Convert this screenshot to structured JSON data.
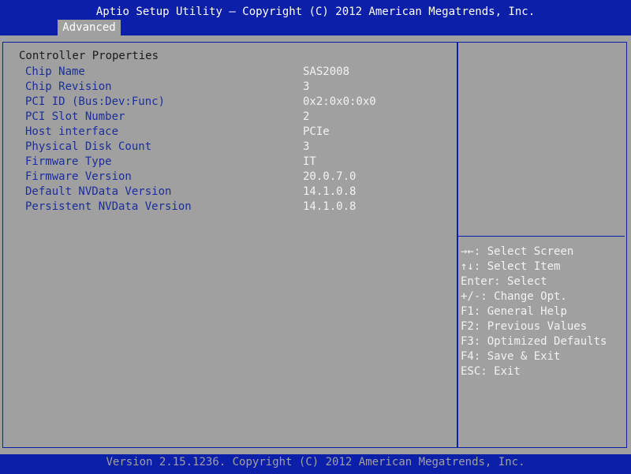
{
  "header": {
    "title": "Aptio Setup Utility – Copyright (C) 2012 American Megatrends, Inc.",
    "active_tab": "Advanced"
  },
  "section_title": "Controller Properties",
  "properties": [
    {
      "label": "Chip Name",
      "value": "SAS2008"
    },
    {
      "label": "Chip Revision",
      "value": "3"
    },
    {
      "label": "PCI ID (Bus:Dev:Func)",
      "value": "0x2:0x0:0x0"
    },
    {
      "label": "PCI Slot Number",
      "value": "2"
    },
    {
      "label": "Host interface",
      "value": "PCIe"
    },
    {
      "label": "Physical Disk Count",
      "value": "3"
    },
    {
      "label": "Firmware Type",
      "value": "IT"
    },
    {
      "label": "Firmware Version",
      "value": "20.0.7.0"
    },
    {
      "label": "Default NVData Version",
      "value": "14.1.0.8"
    },
    {
      "label": "Persistent NVData Version",
      "value": "14.1.0.8"
    }
  ],
  "help": [
    {
      "key": "→←:",
      "text": " Select Screen"
    },
    {
      "key": "↑↓:",
      "text": " Select Item"
    },
    {
      "key": "Enter:",
      "text": " Select"
    },
    {
      "key": "+/-:",
      "text": " Change Opt."
    },
    {
      "key": "F1:",
      "text": " General Help"
    },
    {
      "key": "F2:",
      "text": " Previous Values"
    },
    {
      "key": "F3:",
      "text": " Optimized Defaults"
    },
    {
      "key": "F4:",
      "text": " Save & Exit"
    },
    {
      "key": "ESC:",
      "text": " Exit"
    }
  ],
  "footer": {
    "text": "Version 2.15.1236. Copyright (C) 2012 American Megatrends, Inc."
  },
  "colors": {
    "bios_blue": "#0b1fa8",
    "background_gray": "#a0a0a0",
    "label_blue": "#1b2e9a",
    "value_white": "#f2f2f2"
  }
}
